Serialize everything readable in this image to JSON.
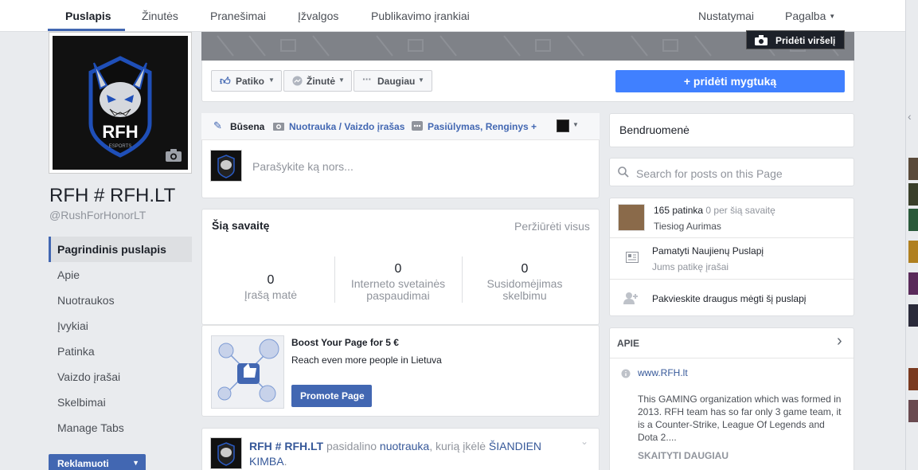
{
  "topnav": {
    "tabs": [
      "Puslapis",
      "Žinutės",
      "Pranešimai",
      "Įžvalgos",
      "Publikavimo įrankiai"
    ],
    "settings": "Nustatymai",
    "help": "Pagalba"
  },
  "cover": {
    "add_cover": "Pridėti viršelį"
  },
  "profile": {
    "name": "RFH # RFH.LT",
    "handle": "@RushForHonorLT",
    "logo_text": "RFH",
    "logo_sub": "ESPORTS"
  },
  "sidenav": {
    "items": [
      "Pagrindinis puslapis",
      "Apie",
      "Nuotraukos",
      "Įvykiai",
      "Patinka",
      "Vaizdo įrašai",
      "Skelbimai",
      "Manage Tabs"
    ],
    "promote": "Reklamuoti"
  },
  "actions": {
    "like": "Patiko",
    "message": "Žinutė",
    "more": "Daugiau",
    "cta": "+ pridėti mygtuką"
  },
  "composer": {
    "tabs": [
      "Būsena",
      "Nuotrauka / Vaizdo įrašas",
      "Pasiūlymas, Renginys +"
    ],
    "placeholder": "Parašykite ką nors..."
  },
  "this_week": {
    "title": "Šią savaitę",
    "view_all": "Peržiūrėti visus",
    "stats": [
      {
        "value": "0",
        "label": "Įrašą matė"
      },
      {
        "value": "0",
        "label": "Interneto svetainės paspaudimai"
      },
      {
        "value": "0",
        "label": "Susidomėjimas skelbimu"
      }
    ]
  },
  "boost": {
    "title": "Boost Your Page for 5 €",
    "subtitle": "Reach even more people in Lietuva",
    "button": "Promote Page"
  },
  "post": {
    "author": "RFH # RFH.LT",
    "shared": "pasidalino",
    "photo": "nuotrauka",
    "rest": ", kurią įkėlė",
    "uploader": "ŠIANDIEN KIMBA",
    "dot": "."
  },
  "right": {
    "community": "Bendruomenė",
    "search_placeholder": "Search for posts on this Page",
    "likes_line": "165 patinka",
    "likes_week": "0 per šią savaitę",
    "liker": "Tiesiog Aurimas",
    "see_feed": "Pamatyti Naujienų Puslapį",
    "see_feed_sub": "Jums patikę įrašai",
    "invite": "Pakvieskite draugus mėgti šį puslapį",
    "about_title": "APIE",
    "website": "www.RFH.lt",
    "description": "This GAMING organization which was formed in 2013. RFH team has so far only 3 game team, it is a Counter-Strike, League Of Legends and Dota 2....",
    "read_more": "SKAITYTI DAUGIAU"
  },
  "colors": {
    "brand": "#4267b2",
    "cta": "#4080ff",
    "background": "#e9ebee"
  }
}
